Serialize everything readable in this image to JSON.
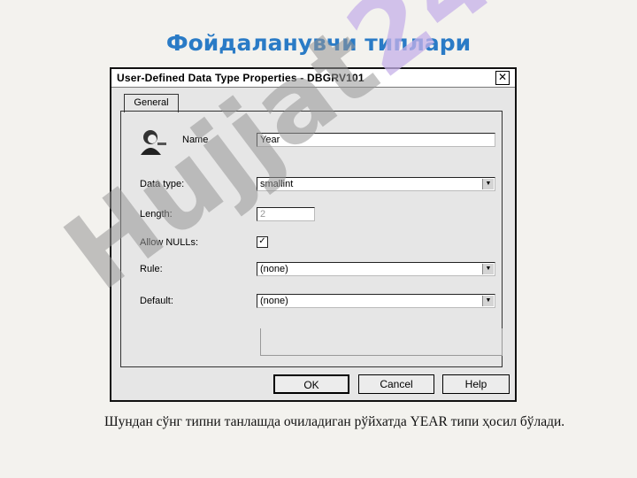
{
  "slide": {
    "title": "Фойдаланувчи типлари",
    "caption": "Шундан сўнг типни танлашда очиладиган рўйхатда YEAR типи ҳосил бўлади."
  },
  "dialog": {
    "title": "User-Defined Data Type Properties - DBGRV101",
    "close_glyph": "✕",
    "tab_label": "General",
    "name_label": "Name",
    "name_value": "Year",
    "data_type_label": "Data type:",
    "data_type_value": "smallint",
    "length_label": "Length:",
    "length_value": "2",
    "allow_nulls_label": "Allow NULLs:",
    "allow_nulls_checked": true,
    "allow_nulls_glyph": "✓",
    "rule_label": "Rule:",
    "rule_value": "(none)",
    "default_label": "Default:",
    "default_value": "(none)",
    "combo_arrow_glyph": "▼",
    "icon": "user-icon",
    "buttons": {
      "ok": "OK",
      "cancel": "Cancel",
      "help": "Help"
    }
  },
  "watermark": {
    "text_main": "Hujjat",
    "text_accent": "24"
  },
  "colors": {
    "title": "#2a7bc6",
    "watermark_gray": "#969696",
    "watermark_purple": "#c6b0e8",
    "background": "#f3f2ee"
  }
}
